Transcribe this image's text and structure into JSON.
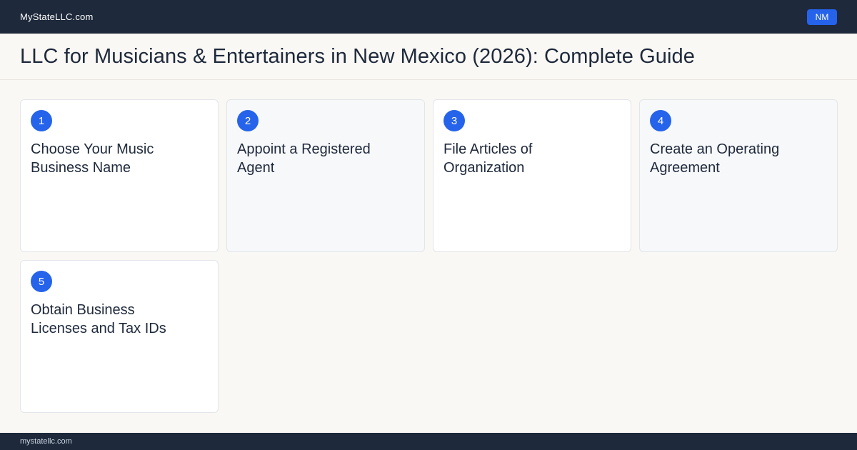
{
  "header": {
    "brand": "MyStateLLC.com",
    "state_badge": "NM"
  },
  "page": {
    "title": "LLC for Musicians & Entertainers in New Mexico (2026): Complete Guide"
  },
  "steps": [
    {
      "number": "1",
      "title": "Choose Your Music Business Name"
    },
    {
      "number": "2",
      "title": "Appoint a Registered Agent"
    },
    {
      "number": "3",
      "title": "File Articles of Organization"
    },
    {
      "number": "4",
      "title": "Create an Operating Agreement"
    },
    {
      "number": "5",
      "title": "Obtain Business Licenses and Tax IDs"
    }
  ],
  "footer": {
    "text": "mystatellc.com"
  },
  "colors": {
    "header_bg": "#1e293b",
    "accent": "#2563eb",
    "page_bg": "#faf8f4"
  }
}
